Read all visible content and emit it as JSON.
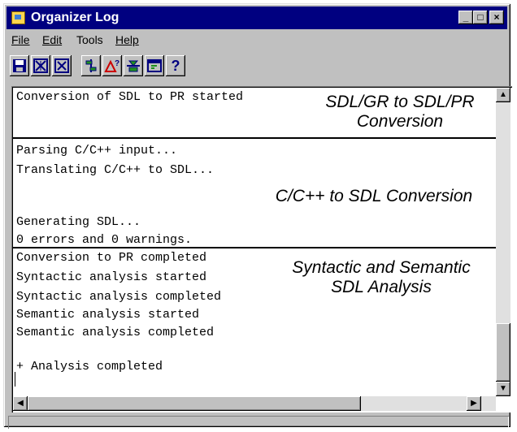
{
  "window": {
    "title": "Organizer Log"
  },
  "title_buttons": {
    "minimize": "_",
    "maximize": "□",
    "close": "×"
  },
  "menu": [
    {
      "label": "File"
    },
    {
      "label": "Edit"
    },
    {
      "label": "Tools"
    },
    {
      "label": "Help"
    }
  ],
  "toolbar": {
    "icons": [
      "save-icon",
      "clear-all-icon",
      "close-log-icon",
      "organizer-view-icon",
      "analyze-icon",
      "browse-icon",
      "editor-icon",
      "help-icon"
    ],
    "help_label": "?"
  },
  "log": {
    "lines": [
      "Conversion of SDL to PR started",
      "Parsing C/C++ input...",
      "Translating C/C++ to SDL...",
      "Generating SDL...",
      "0 errors and 0 warnings.",
      "Conversion to PR completed",
      "Syntactic analysis started",
      "Syntactic analysis completed",
      "Semantic analysis started",
      "Semantic analysis completed",
      "+ Analysis completed"
    ]
  },
  "annotations": [
    {
      "line1": "SDL/GR to SDL/PR",
      "line2": "Conversion"
    },
    {
      "line1": "C/C++ to  SDL Conversion"
    },
    {
      "line1": "Syntactic and Semantic",
      "line2": "SDL Analysis"
    }
  ],
  "scroll": {
    "up": "▲",
    "down": "▼",
    "left": "◀",
    "right": "▶"
  },
  "colors": {
    "titlebar": "#000080",
    "chrome": "#c0c0c0",
    "text_area": "#ffffff"
  }
}
